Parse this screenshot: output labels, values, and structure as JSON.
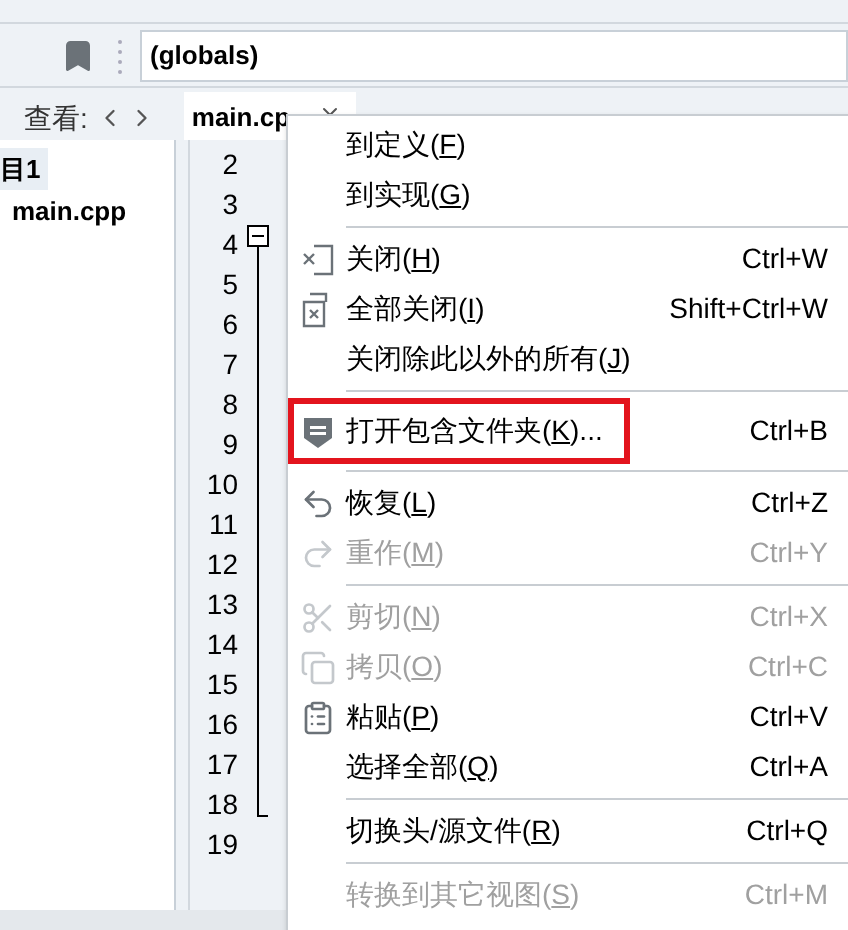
{
  "scope_field": {
    "value": "(globals)"
  },
  "panel_tabs": {
    "label": "查看:"
  },
  "editor_tab": {
    "label": "main.cp"
  },
  "project_tree": [
    {
      "label": "目1",
      "selected": true
    },
    {
      "label": "main.cpp",
      "selected": false
    }
  ],
  "line_numbers": [
    "2",
    "3",
    "4",
    "5",
    "6",
    "7",
    "8",
    "9",
    "10",
    "11",
    "12",
    "13",
    "14",
    "15",
    "16",
    "17",
    "18",
    "19"
  ],
  "context_menu": [
    {
      "kind": "item",
      "prefix": "到定义(",
      "mnemonic": "F",
      "suffix": ")",
      "disabled": false,
      "highlighted": false
    },
    {
      "kind": "item",
      "prefix": "到实现(",
      "mnemonic": "G",
      "suffix": ")",
      "disabled": false,
      "highlighted": false
    },
    {
      "kind": "separator"
    },
    {
      "kind": "item",
      "prefix": "关闭(",
      "mnemonic": "H",
      "suffix": ")",
      "shortcut": "Ctrl+W",
      "disabled": false,
      "highlighted": false
    },
    {
      "kind": "item",
      "prefix": "全部关闭(",
      "mnemonic": "I",
      "suffix": ")",
      "shortcut": "Shift+Ctrl+W",
      "disabled": false,
      "highlighted": false
    },
    {
      "kind": "item",
      "prefix": "关闭除此以外的所有(",
      "mnemonic": "J",
      "suffix": ")",
      "disabled": false,
      "highlighted": false
    },
    {
      "kind": "separator"
    },
    {
      "kind": "item",
      "prefix": "打开包含文件夹(",
      "mnemonic": "K",
      "suffix": ")...",
      "shortcut": "Ctrl+B",
      "disabled": false,
      "highlighted": true
    },
    {
      "kind": "separator"
    },
    {
      "kind": "item",
      "prefix": "恢复(",
      "mnemonic": "L",
      "suffix": ")",
      "shortcut": "Ctrl+Z",
      "disabled": false,
      "highlighted": false
    },
    {
      "kind": "item",
      "prefix": "重作(",
      "mnemonic": "M",
      "suffix": ")",
      "shortcut": "Ctrl+Y",
      "disabled": true,
      "highlighted": false
    },
    {
      "kind": "separator"
    },
    {
      "kind": "item",
      "prefix": "剪切(",
      "mnemonic": "N",
      "suffix": ")",
      "shortcut": "Ctrl+X",
      "disabled": true,
      "highlighted": false
    },
    {
      "kind": "item",
      "prefix": "拷贝(",
      "mnemonic": "O",
      "suffix": ")",
      "shortcut": "Ctrl+C",
      "disabled": true,
      "highlighted": false
    },
    {
      "kind": "item",
      "prefix": "粘贴(",
      "mnemonic": "P",
      "suffix": ")",
      "shortcut": "Ctrl+V",
      "disabled": false,
      "highlighted": false
    },
    {
      "kind": "item",
      "prefix": "选择全部(",
      "mnemonic": "Q",
      "suffix": ")",
      "shortcut": "Ctrl+A",
      "disabled": false,
      "highlighted": false
    },
    {
      "kind": "separator"
    },
    {
      "kind": "item",
      "prefix": "切换头/源文件(",
      "mnemonic": "R",
      "suffix": ")",
      "shortcut": "Ctrl+Q",
      "disabled": false,
      "highlighted": false
    },
    {
      "kind": "separator"
    },
    {
      "kind": "item",
      "prefix": "转换到其它视图(",
      "mnemonic": "S",
      "suffix": ")",
      "shortcut": "Ctrl+M",
      "disabled": true,
      "highlighted": false
    }
  ]
}
